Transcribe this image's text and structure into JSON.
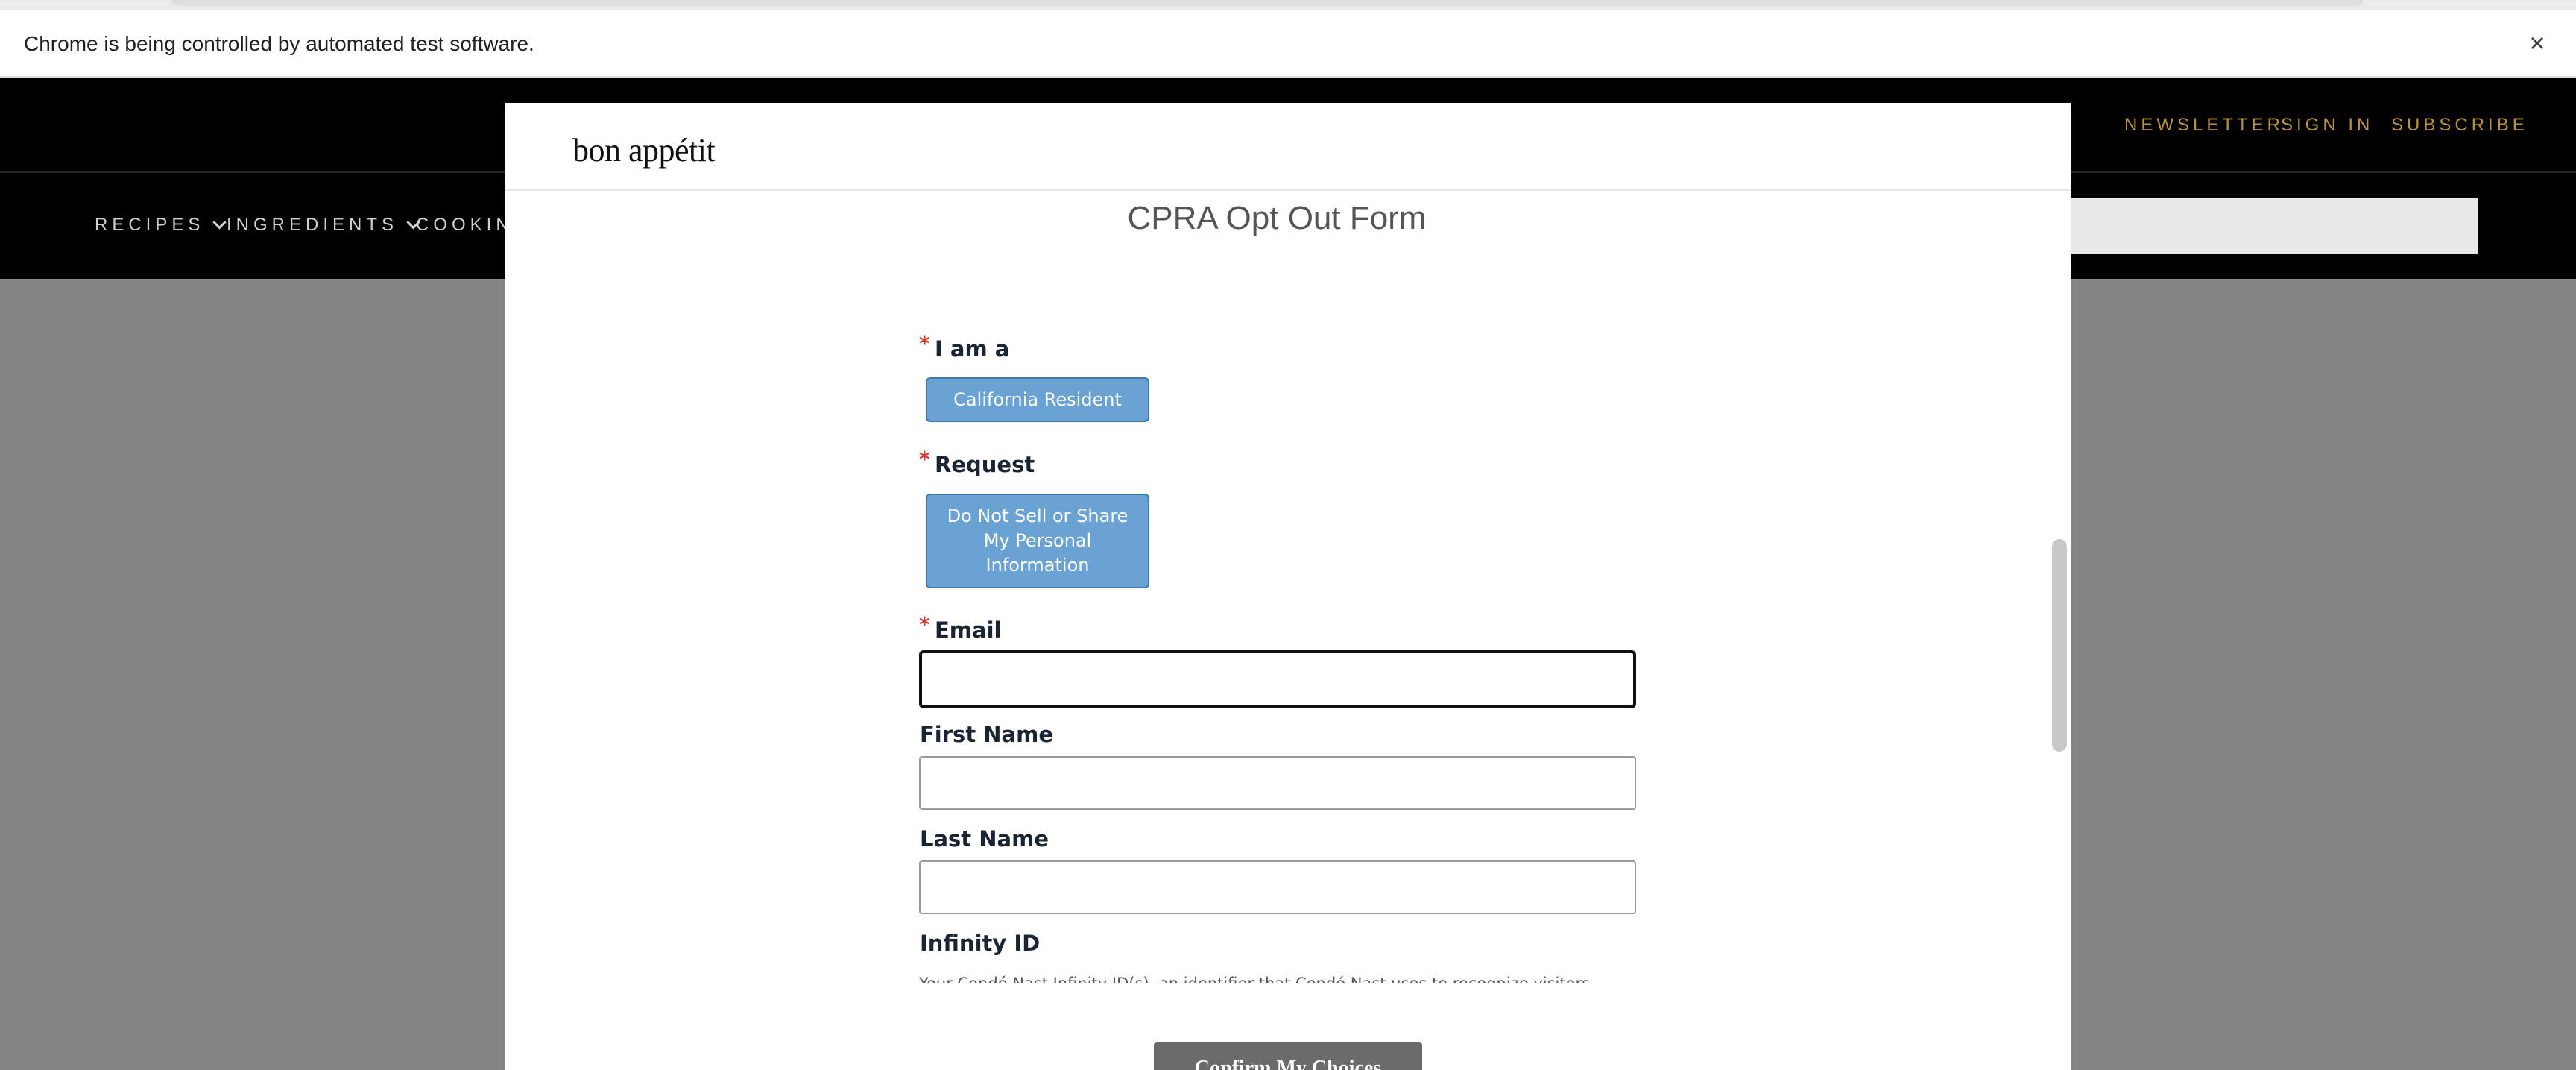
{
  "browser": {
    "infobar_message": "Chrome is being controlled by automated test software.",
    "close_glyph": "×"
  },
  "site_header": {
    "top_links": [
      "NEWSLETTER",
      "SIGN IN",
      "SUBSCRIBE"
    ],
    "nav": [
      "RECIPES",
      "INGREDIENTS",
      "COOKIN"
    ],
    "accent_color": "#b9933b"
  },
  "modal": {
    "logo": "bon appétit",
    "title": "CPRA Opt Out Form",
    "required_mark": "*",
    "fields": {
      "i_am_a": {
        "label": "I am a",
        "option": "California Resident"
      },
      "request": {
        "label": "Request",
        "option": "Do Not Sell or Share My Personal Information"
      },
      "email": {
        "label": "Email",
        "value": ""
      },
      "first_name": {
        "label": "First Name",
        "value": ""
      },
      "last_name": {
        "label": "Last Name",
        "value": ""
      },
      "infinity_id": {
        "label": "Infinity ID",
        "description": "Your Condé Nast Infinity ID(s), an identifier that Condé Nast uses to recognize visitors"
      }
    },
    "confirm_button": "Confirm My Choices"
  }
}
